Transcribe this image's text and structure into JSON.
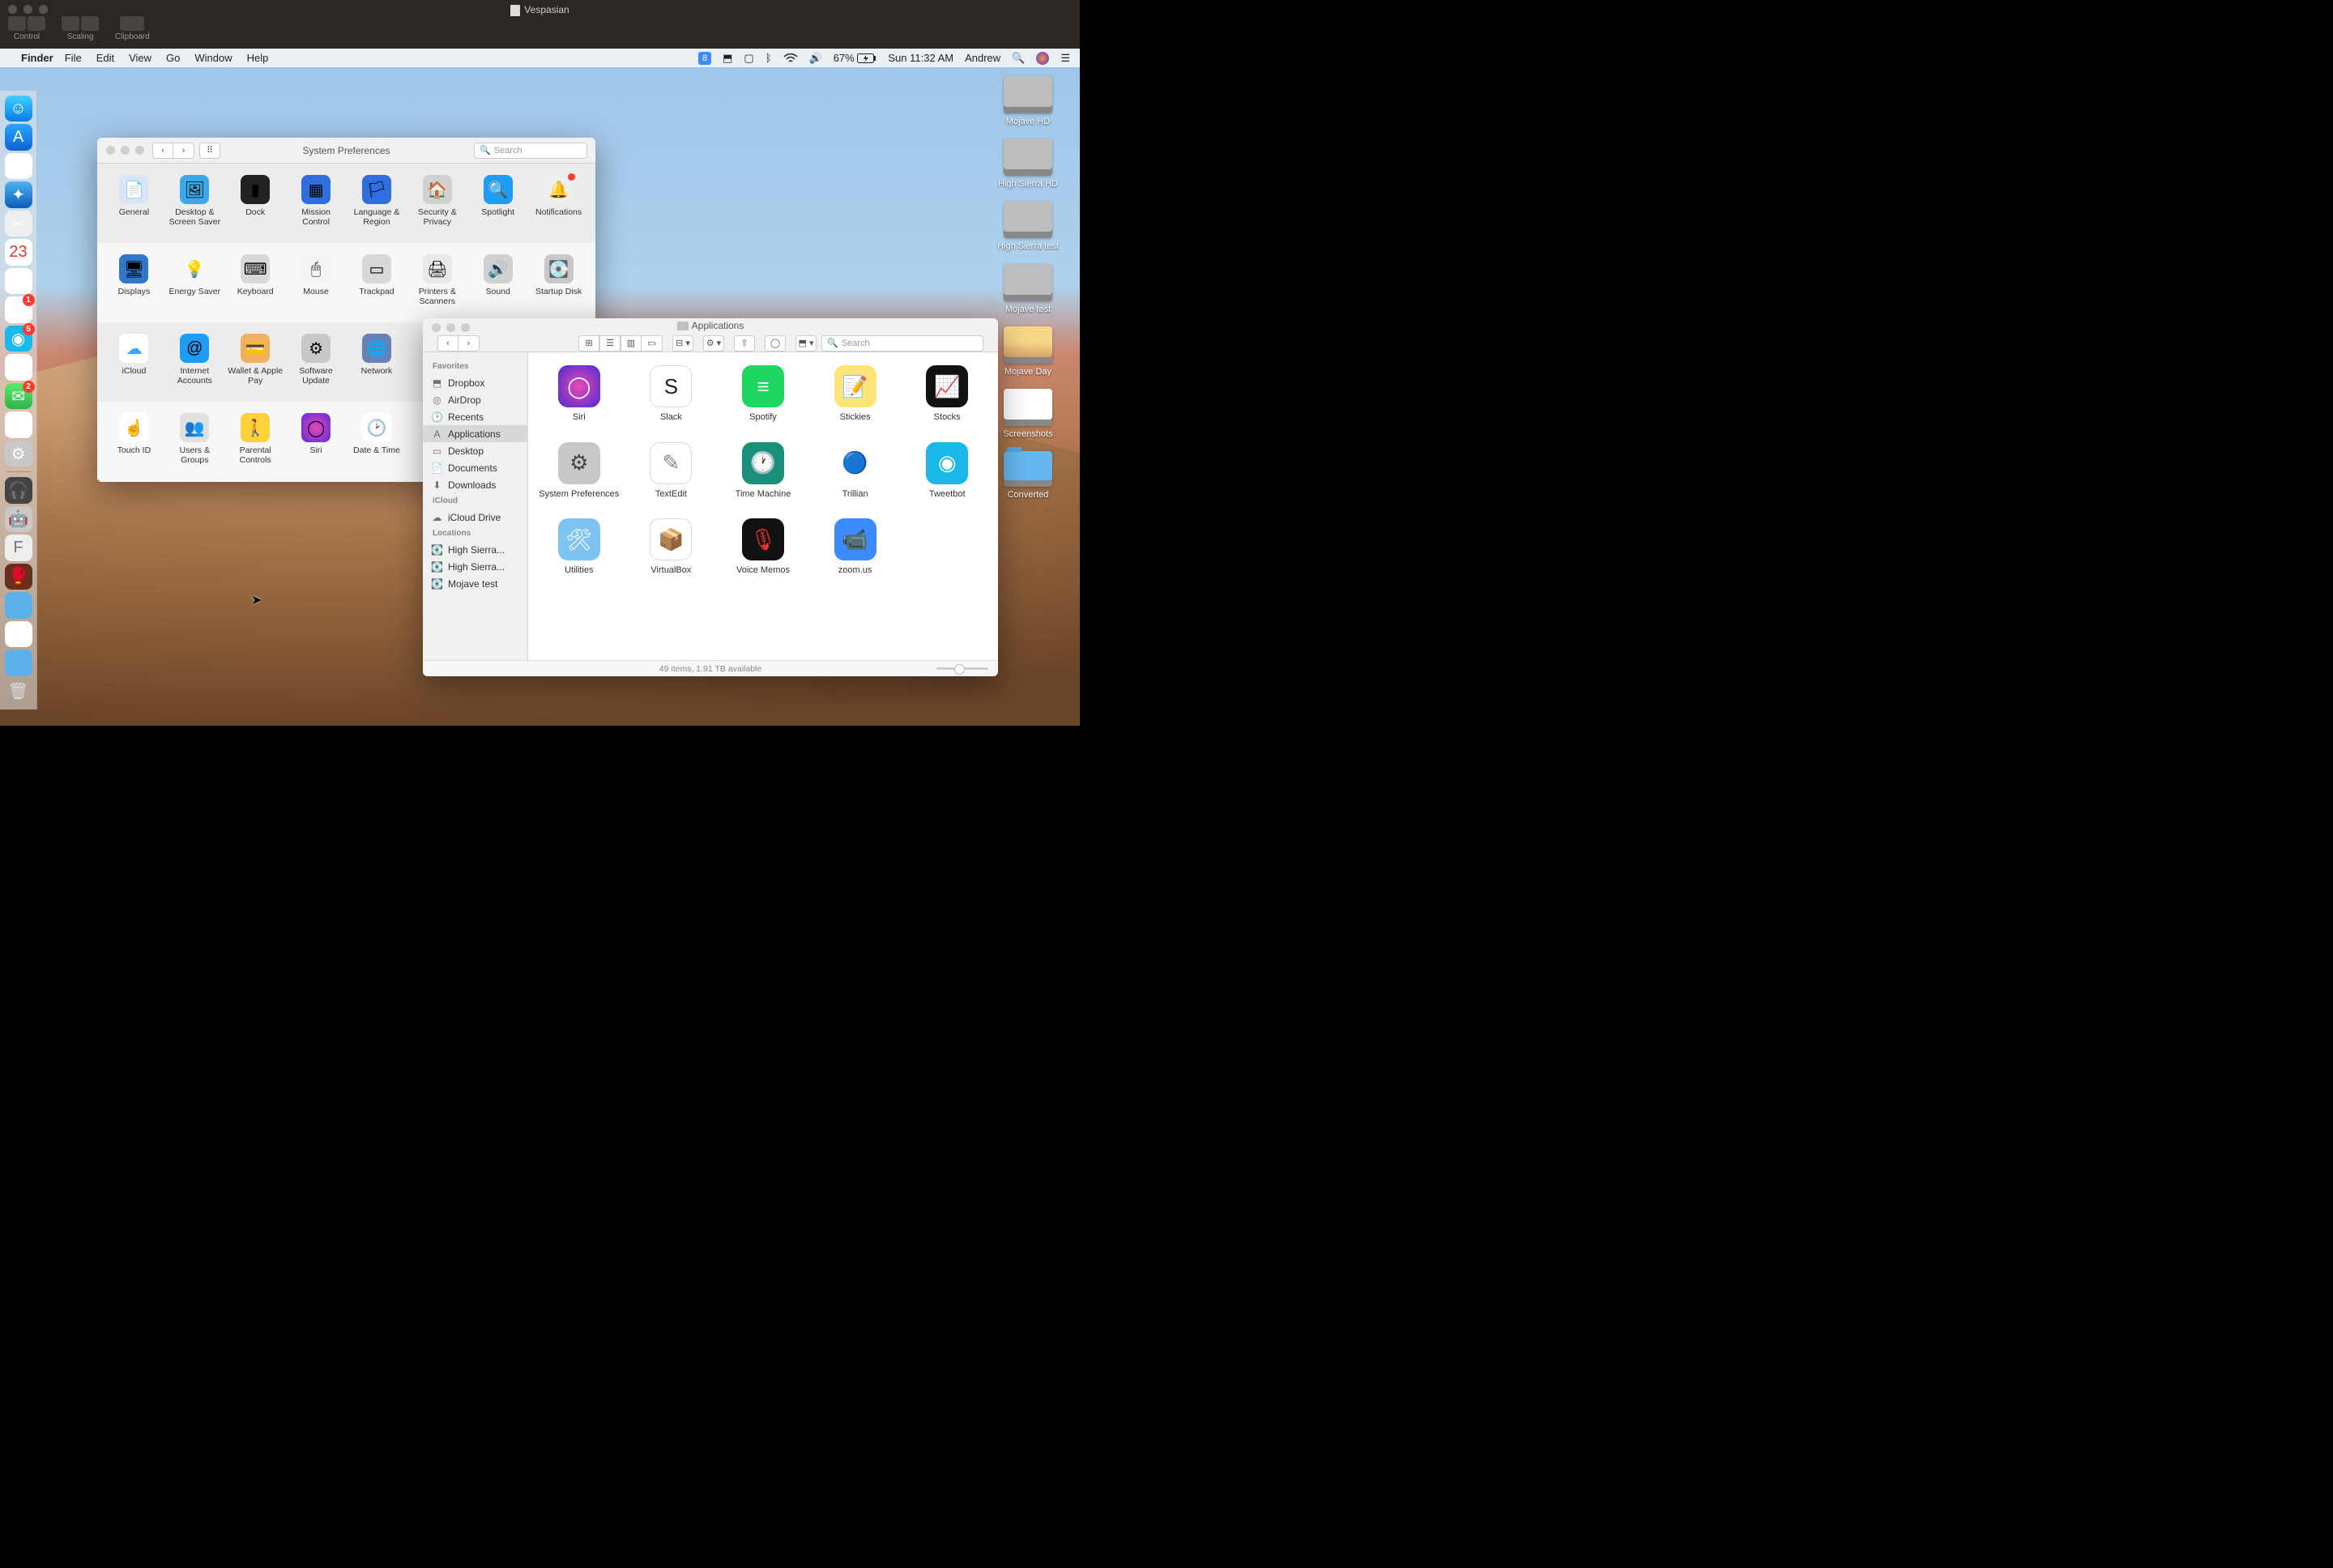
{
  "vnc": {
    "title": "Vespasian",
    "tools": [
      "Control",
      "Scaling",
      "Clipboard"
    ]
  },
  "menubar": {
    "app": "Finder",
    "menus": [
      "File",
      "Edit",
      "View",
      "Go",
      "Window",
      "Help"
    ],
    "battery": "67%",
    "clock": "Sun 11:32 AM",
    "user": "Andrew"
  },
  "dock_items": [
    {
      "name": "finder",
      "bg": "linear-gradient(#3fd1ff,#0a7be8)",
      "glyph": "☺"
    },
    {
      "name": "app-store",
      "bg": "linear-gradient(#2aa7ff,#0b62d4)",
      "glyph": "A"
    },
    {
      "name": "chrome",
      "bg": "#fff",
      "glyph": "◯"
    },
    {
      "name": "safari",
      "bg": "linear-gradient(#4fb4f0,#0a5bb8)",
      "glyph": "✦"
    },
    {
      "name": "screenshot",
      "bg": "#eee",
      "glyph": "✂"
    },
    {
      "name": "calendar",
      "bg": "#fff",
      "glyph": "23",
      "text": "#e33"
    },
    {
      "name": "reminders",
      "bg": "#fff",
      "glyph": "☰"
    },
    {
      "name": "slack",
      "bg": "#fff",
      "glyph": "§",
      "badge": "1"
    },
    {
      "name": "tweetbot",
      "bg": "#1ab8e8",
      "glyph": "◉",
      "badge": "5"
    },
    {
      "name": "photos",
      "bg": "#fff",
      "glyph": "✿"
    },
    {
      "name": "messages",
      "bg": "linear-gradient(#5fe86e,#2db54a)",
      "glyph": "✉",
      "badge": "2"
    },
    {
      "name": "itunes",
      "bg": "#fff",
      "glyph": "♪"
    },
    {
      "name": "system-preferences",
      "bg": "#c8c8c8",
      "glyph": "⚙"
    }
  ],
  "dock_extra": [
    {
      "name": "headphones",
      "bg": "#444",
      "glyph": "🎧"
    },
    {
      "name": "automator",
      "bg": "#c8c8c8",
      "glyph": "🤖"
    },
    {
      "name": "font-book",
      "bg": "#eee",
      "glyph": "F",
      "text": "#777"
    },
    {
      "name": "game",
      "bg": "#6a2e1e",
      "glyph": "🥊"
    },
    {
      "name": "folder1",
      "bg": "#5ab1ea",
      "glyph": ""
    },
    {
      "name": "folder2",
      "bg": "#fff",
      "glyph": ""
    },
    {
      "name": "folder3",
      "bg": "#5ab1ea",
      "glyph": ""
    },
    {
      "name": "trash",
      "bg": "transparent",
      "glyph": "🗑",
      "text": "#ddd"
    }
  ],
  "desktop_icons": [
    {
      "name": "mojave-hd",
      "label": "Mojave HD",
      "type": "drive"
    },
    {
      "name": "high-sierra-hd",
      "label": "High Sierra HD",
      "type": "drive"
    },
    {
      "name": "high-sierra-test",
      "label": "High Sierra test",
      "type": "drive"
    },
    {
      "name": "mojave-test",
      "label": "Mojave test",
      "type": "drive"
    },
    {
      "name": "mojave-day",
      "label": "Mojave Day",
      "type": "img"
    },
    {
      "name": "screenshots",
      "label": "Screenshots",
      "type": "shots"
    },
    {
      "name": "converted",
      "label": "Converted",
      "type": "folder"
    }
  ],
  "sysprefs": {
    "title": "System Preferences",
    "search_placeholder": "Search",
    "rows": [
      [
        {
          "name": "general",
          "label": "General",
          "bg": "#d8e6f4",
          "glyph": "📄"
        },
        {
          "name": "desktop-screensaver",
          "label": "Desktop & Screen Saver",
          "bg": "#3ba8e8",
          "glyph": "🖼"
        },
        {
          "name": "dock",
          "label": "Dock",
          "bg": "#222",
          "glyph": "▮"
        },
        {
          "name": "mission-control",
          "label": "Mission Control",
          "bg": "#2e6ede",
          "glyph": "▦"
        },
        {
          "name": "language-region",
          "label": "Language & Region",
          "bg": "#2e6ede",
          "glyph": "🏳"
        },
        {
          "name": "security-privacy",
          "label": "Security & Privacy",
          "bg": "#d0d0d0",
          "glyph": "🏠"
        },
        {
          "name": "spotlight",
          "label": "Spotlight",
          "bg": "#1e9df6",
          "glyph": "🔍"
        },
        {
          "name": "notifications",
          "label": "Notifications",
          "bg": "#eee",
          "glyph": "🔔",
          "dot": true
        }
      ],
      [
        {
          "name": "displays",
          "label": "Displays",
          "bg": "#3077c9",
          "glyph": "🖥"
        },
        {
          "name": "energy-saver",
          "label": "Energy Saver",
          "bg": "transparent",
          "glyph": "💡"
        },
        {
          "name": "keyboard",
          "label": "Keyboard",
          "bg": "#d8d8d8",
          "glyph": "⌨"
        },
        {
          "name": "mouse",
          "label": "Mouse",
          "bg": "#f4f4f4",
          "glyph": "🖱"
        },
        {
          "name": "trackpad",
          "label": "Trackpad",
          "bg": "#d8d8d8",
          "glyph": "▭"
        },
        {
          "name": "printers-scanners",
          "label": "Printers & Scanners",
          "bg": "#e8e8e8",
          "glyph": "🖨"
        },
        {
          "name": "sound",
          "label": "Sound",
          "bg": "#d0d0d0",
          "glyph": "🔊"
        },
        {
          "name": "startup-disk",
          "label": "Startup Disk",
          "bg": "#c8c8c8",
          "glyph": "💽"
        }
      ],
      [
        {
          "name": "icloud",
          "label": "iCloud",
          "bg": "#fff",
          "glyph": "☁",
          "text": "#39a7f1"
        },
        {
          "name": "internet-accounts",
          "label": "Internet Accounts",
          "bg": "#1e9df6",
          "glyph": "@"
        },
        {
          "name": "wallet-apple-pay",
          "label": "Wallet & Apple Pay",
          "bg": "#f0b060",
          "glyph": "💳"
        },
        {
          "name": "software-update",
          "label": "Software Update",
          "bg": "#c8c8c8",
          "glyph": "⚙"
        },
        {
          "name": "network",
          "label": "Network",
          "bg": "#6880b8",
          "glyph": "🌐"
        }
      ],
      [
        {
          "name": "touch-id",
          "label": "Touch ID",
          "bg": "#fff",
          "glyph": "☝",
          "text": "#ea3a6c"
        },
        {
          "name": "users-groups",
          "label": "Users & Groups",
          "bg": "#e0e0e0",
          "glyph": "👥",
          "text": "#444"
        },
        {
          "name": "parental-controls",
          "label": "Parental Controls",
          "bg": "#ffd23a",
          "glyph": "🚶"
        },
        {
          "name": "siri",
          "label": "Siri",
          "bg": "radial-gradient(circle,#e94ab8,#5a2ad8)",
          "glyph": "◯"
        },
        {
          "name": "date-time",
          "label": "Date & Time",
          "bg": "#fff",
          "glyph": "🕑"
        }
      ]
    ]
  },
  "finder": {
    "title": "Applications",
    "search_placeholder": "Search",
    "sidebar": {
      "sections": [
        {
          "header": "Favorites",
          "items": [
            {
              "name": "dropbox",
              "label": "Dropbox",
              "icon": "⬒"
            },
            {
              "name": "airdrop",
              "label": "AirDrop",
              "icon": "◎"
            },
            {
              "name": "recents",
              "label": "Recents",
              "icon": "🕑"
            },
            {
              "name": "applications",
              "label": "Applications",
              "icon": "A",
              "sel": true
            },
            {
              "name": "desktop",
              "label": "Desktop",
              "icon": "▭"
            },
            {
              "name": "documents",
              "label": "Documents",
              "icon": "📄"
            },
            {
              "name": "downloads",
              "label": "Downloads",
              "icon": "⬇"
            }
          ]
        },
        {
          "header": "iCloud",
          "items": [
            {
              "name": "icloud-drive",
              "label": "iCloud Drive",
              "icon": "☁"
            }
          ]
        },
        {
          "header": "Locations",
          "items": [
            {
              "name": "high-sierra-1",
              "label": "High Sierra...",
              "icon": "💽"
            },
            {
              "name": "high-sierra-2",
              "label": "High Sierra...",
              "icon": "💽"
            },
            {
              "name": "mojave-test",
              "label": "Mojave test",
              "icon": "💽"
            }
          ]
        }
      ]
    },
    "apps": [
      {
        "name": "siri",
        "label": "Siri",
        "bg": "radial-gradient(circle,#e94ab8,#4a2ad0)",
        "glyph": "◯"
      },
      {
        "name": "slack",
        "label": "Slack",
        "bg": "#fff",
        "glyph": "S",
        "text": "#222",
        "outline": true
      },
      {
        "name": "spotify",
        "label": "Spotify",
        "bg": "#1ed760",
        "glyph": "≡"
      },
      {
        "name": "stickies",
        "label": "Stickies",
        "bg": "#ffe477",
        "glyph": "📝",
        "text": "#c86"
      },
      {
        "name": "stocks",
        "label": "Stocks",
        "bg": "#111",
        "glyph": "📈"
      },
      {
        "name": "system-preferences",
        "label": "System Preferences",
        "bg": "#c8c8c8",
        "glyph": "⚙",
        "text": "#444"
      },
      {
        "name": "textedit",
        "label": "TextEdit",
        "bg": "#fff",
        "glyph": "✎",
        "text": "#888",
        "outline": true
      },
      {
        "name": "time-machine",
        "label": "Time Machine",
        "bg": "#1a8f7a",
        "glyph": "🕐"
      },
      {
        "name": "trillian",
        "label": "Trillian",
        "bg": "transparent",
        "glyph": "🔵"
      },
      {
        "name": "tweetbot",
        "label": "Tweetbot",
        "bg": "#1ab8e8",
        "glyph": "◉"
      },
      {
        "name": "utilities",
        "label": "Utilities",
        "bg": "#7ec4f2",
        "glyph": "🛠"
      },
      {
        "name": "virtualbox",
        "label": "VirtualBox",
        "bg": "#fff",
        "glyph": "📦",
        "text": "#2d5aa8",
        "outline": true
      },
      {
        "name": "voice-memos",
        "label": "Voice Memos",
        "bg": "#111",
        "glyph": "🎙",
        "text": "#e33"
      },
      {
        "name": "zoom",
        "label": "zoom.us",
        "bg": "#3d8cff",
        "glyph": "📹"
      }
    ],
    "status": "49 items, 1.91 TB available"
  }
}
